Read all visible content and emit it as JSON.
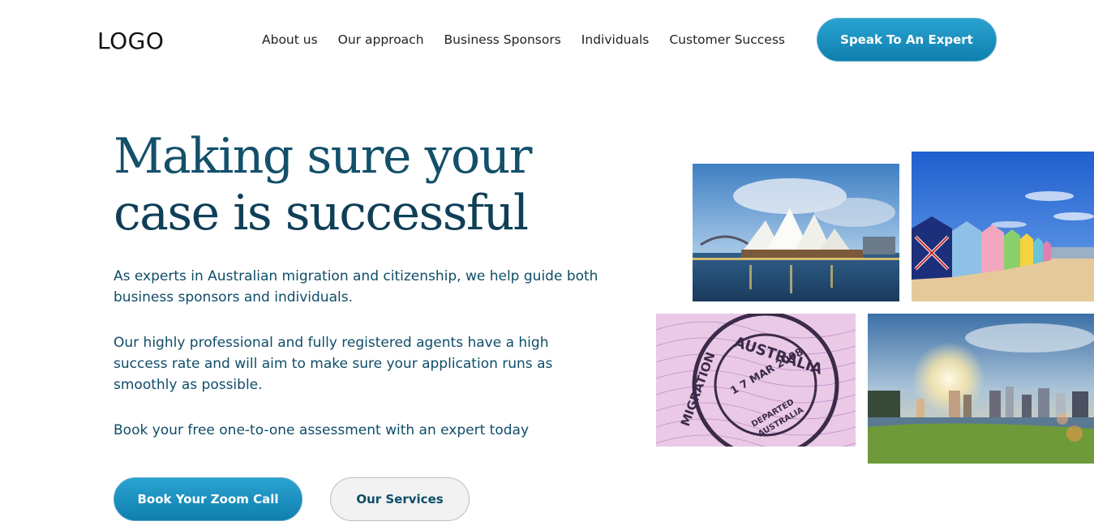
{
  "header": {
    "logo": "LOGO",
    "nav": [
      "About us",
      "Our approach",
      "Business Sponsors",
      "Individuals",
      "Customer Success"
    ],
    "cta_label": "Speak To An Expert"
  },
  "hero": {
    "title_line1": "Making sure your",
    "title_line2": "case is successful",
    "paragraph1": "As experts in Australian migration and citizenship, we help guide both business sponsors and individuals.",
    "paragraph2": "Our highly professional and fully registered agents have a high success rate and will aim to make sure your application runs as smoothly as possible.",
    "paragraph3": "Book your free one-to-one assessment with an expert today",
    "primary_button": "Book Your Zoom Call",
    "secondary_button": "Our Services"
  },
  "images": {
    "stamp": {
      "text_top": "AUSTRALIA",
      "text_side": "MIGRATION",
      "date": "1 7 MAR 2008",
      "line2": "DEPARTED",
      "line3": "AUSTRALIA"
    }
  },
  "colors": {
    "accent": "#1a8fc0",
    "heading": "#13506a",
    "body_text": "#0e4d68"
  }
}
